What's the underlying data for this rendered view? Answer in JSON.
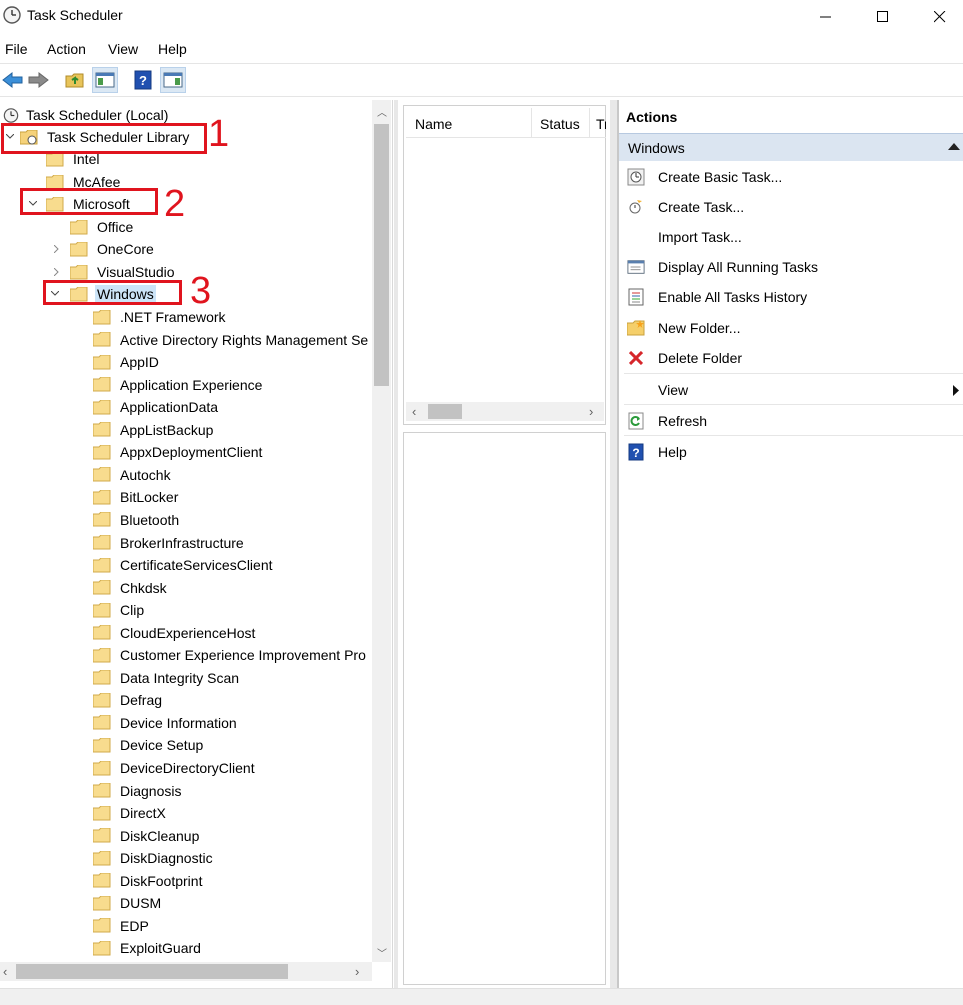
{
  "window": {
    "title": "Task Scheduler"
  },
  "menu": [
    "File",
    "Action",
    "View",
    "Help"
  ],
  "toolbar": [
    "back-icon",
    "forward-icon",
    "up-folder-icon",
    "console-tree-icon",
    "help-icon",
    "action-pane-icon"
  ],
  "tree": {
    "root": "Task Scheduler (Local)",
    "library": "Task Scheduler Library",
    "level1": [
      "Intel",
      "McAfee",
      "Microsoft"
    ],
    "level2": [
      "Office",
      "OneCore",
      "VisualStudio",
      "Windows"
    ],
    "windows_children": [
      ".NET Framework",
      "Active Directory Rights Management Se",
      "AppID",
      "Application Experience",
      "ApplicationData",
      "AppListBackup",
      "AppxDeploymentClient",
      "Autochk",
      "BitLocker",
      "Bluetooth",
      "BrokerInfrastructure",
      "CertificateServicesClient",
      "Chkdsk",
      "Clip",
      "CloudExperienceHost",
      "Customer Experience Improvement Pro",
      "Data Integrity Scan",
      "Defrag",
      "Device Information",
      "Device Setup",
      "DeviceDirectoryClient",
      "Diagnosis",
      "DirectX",
      "DiskCleanup",
      "DiskDiagnostic",
      "DiskFootprint",
      "DUSM",
      "EDP",
      "ExploitGuard"
    ],
    "selected": "Windows"
  },
  "list": {
    "columns": [
      "Name",
      "Status",
      "Tr"
    ]
  },
  "actions": {
    "header": "Actions",
    "section": "Windows",
    "items": [
      {
        "label": "Create Basic Task...",
        "icon": "create-basic-task-icon"
      },
      {
        "label": "Create Task...",
        "icon": "create-task-icon"
      },
      {
        "label": "Import Task...",
        "icon": ""
      },
      {
        "label": "Display All Running Tasks",
        "icon": "running-tasks-icon"
      },
      {
        "label": "Enable All Tasks History",
        "icon": "tasks-history-icon"
      },
      {
        "label": "New Folder...",
        "icon": "new-folder-icon"
      },
      {
        "label": "Delete Folder",
        "icon": "delete-icon"
      },
      {
        "label": "View",
        "icon": ""
      },
      {
        "label": "Refresh",
        "icon": "refresh-icon"
      },
      {
        "label": "Help",
        "icon": "help-icon"
      }
    ]
  },
  "annotations": [
    "1",
    "2",
    "3"
  ]
}
